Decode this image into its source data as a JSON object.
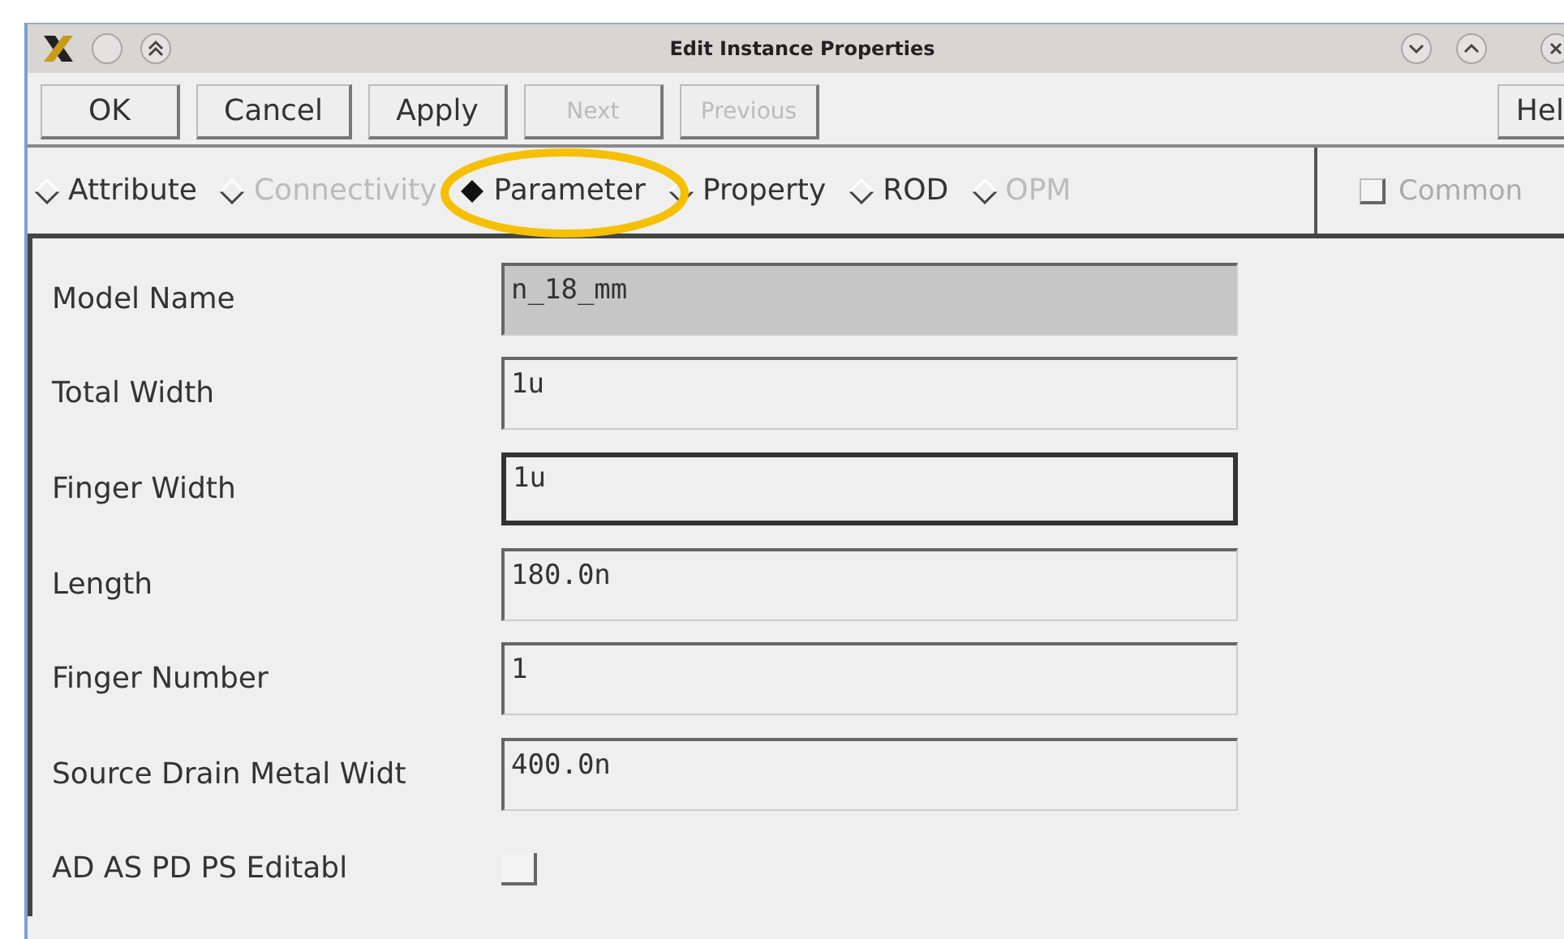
{
  "window": {
    "title": "Edit Instance Properties"
  },
  "buttons": [
    {
      "label": "OK",
      "disabled": false
    },
    {
      "label": "Cancel",
      "disabled": false
    },
    {
      "label": "Apply",
      "disabled": false
    },
    {
      "label": "Next",
      "disabled": true
    },
    {
      "label": "Previous",
      "disabled": true
    }
  ],
  "help_button": {
    "label": "Hel"
  },
  "modes": [
    {
      "label": "Attribute",
      "selected": false,
      "disabled": false
    },
    {
      "label": "Connectivity",
      "selected": false,
      "disabled": true
    },
    {
      "label": "Parameter",
      "selected": true,
      "disabled": false
    },
    {
      "label": "Property",
      "selected": false,
      "disabled": false
    },
    {
      "label": "ROD",
      "selected": false,
      "disabled": false
    },
    {
      "label": "OPM",
      "selected": false,
      "disabled": true
    }
  ],
  "common": {
    "label": "Common",
    "checked": false,
    "disabled": true
  },
  "fields": [
    {
      "kind": "text",
      "label": "Model Name",
      "value": "n_18_mm",
      "readonly": true,
      "focused": false
    },
    {
      "kind": "text",
      "label": "Total Width",
      "value": "1u",
      "readonly": false,
      "focused": false
    },
    {
      "kind": "text",
      "label": "Finger Width",
      "value": "1u",
      "readonly": false,
      "focused": true
    },
    {
      "kind": "text",
      "label": "Length",
      "value": "180.0n",
      "readonly": false,
      "focused": false
    },
    {
      "kind": "text",
      "label": "Finger Number",
      "value": "1",
      "readonly": false,
      "focused": false
    },
    {
      "kind": "text",
      "label": "Source Drain Metal Widt",
      "value": "400.0n",
      "readonly": false,
      "focused": false
    },
    {
      "kind": "checkbox",
      "label": "AD AS PD PS Editabl",
      "checked": false
    }
  ],
  "annotation": {
    "kind": "ellipse"
  }
}
